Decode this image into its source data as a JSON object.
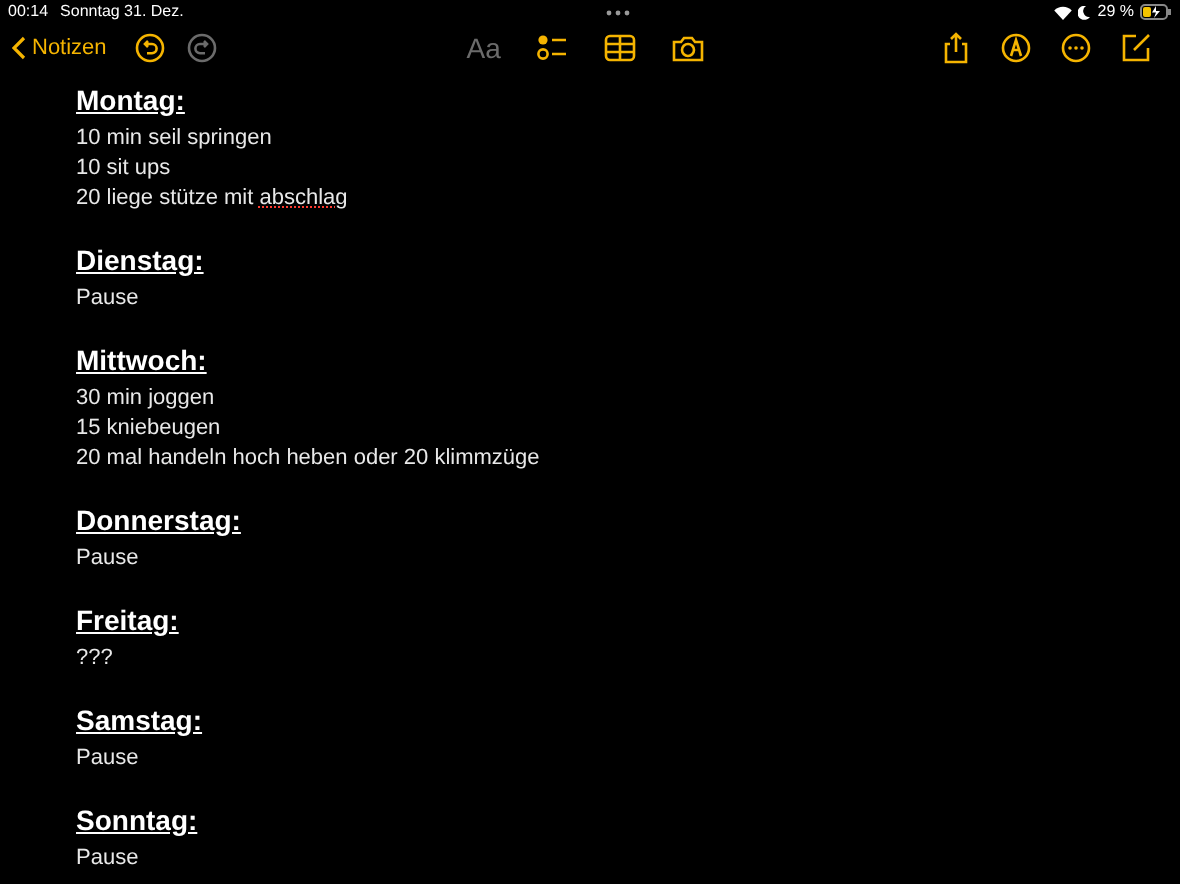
{
  "status_bar": {
    "time": "00:14",
    "date": "Sonntag 31. Dez.",
    "battery": "29 %"
  },
  "toolbar": {
    "back": "Notizen",
    "left_tools": [
      {
        "kind": "undo",
        "disabled": false
      },
      {
        "kind": "redo",
        "disabled": true
      }
    ],
    "center_tools": [
      {
        "kind": "format",
        "label": "Aa",
        "disabled": true
      },
      {
        "kind": "checklist",
        "disabled": false
      },
      {
        "kind": "table",
        "disabled": false
      },
      {
        "kind": "camera",
        "disabled": false
      }
    ],
    "right_tools": [
      {
        "kind": "share",
        "disabled": false
      },
      {
        "kind": "markup",
        "disabled": false
      },
      {
        "kind": "more",
        "disabled": false
      },
      {
        "kind": "compose",
        "disabled": false
      }
    ]
  },
  "note": {
    "sections": [
      {
        "heading": "Montag:",
        "lines": [
          {
            "parts": [
              {
                "text": "10 min seil springen",
                "misspelled": false
              }
            ]
          },
          {
            "parts": [
              {
                "text": "10 sit ups",
                "misspelled": false
              }
            ]
          },
          {
            "parts": [
              {
                "text": "20 liege stütze mit ",
                "misspelled": false
              },
              {
                "text": "abschlag",
                "misspelled": true
              }
            ]
          }
        ]
      },
      {
        "heading": "Dienstag:",
        "lines": [
          {
            "parts": [
              {
                "text": "Pause",
                "misspelled": false
              }
            ]
          }
        ]
      },
      {
        "heading": "Mittwoch:",
        "lines": [
          {
            "parts": [
              {
                "text": "30 min joggen",
                "misspelled": false
              }
            ]
          },
          {
            "parts": [
              {
                "text": "15 kniebeugen",
                "misspelled": false
              }
            ]
          },
          {
            "parts": [
              {
                "text": "20 mal handeln hoch heben oder 20 klimmzüge",
                "misspelled": false
              }
            ]
          }
        ]
      },
      {
        "heading": "Donnerstag:",
        "lines": [
          {
            "parts": [
              {
                "text": "Pause",
                "misspelled": false
              }
            ]
          }
        ]
      },
      {
        "heading": "Freitag:",
        "lines": [
          {
            "parts": [
              {
                "text": "???",
                "misspelled": false
              }
            ]
          }
        ]
      },
      {
        "heading": "Samstag:",
        "lines": [
          {
            "parts": [
              {
                "text": "Pause",
                "misspelled": false
              }
            ]
          }
        ]
      },
      {
        "heading": "Sonntag:",
        "lines": [
          {
            "parts": [
              {
                "text": "Pause",
                "misspelled": false
              }
            ]
          }
        ]
      }
    ]
  }
}
